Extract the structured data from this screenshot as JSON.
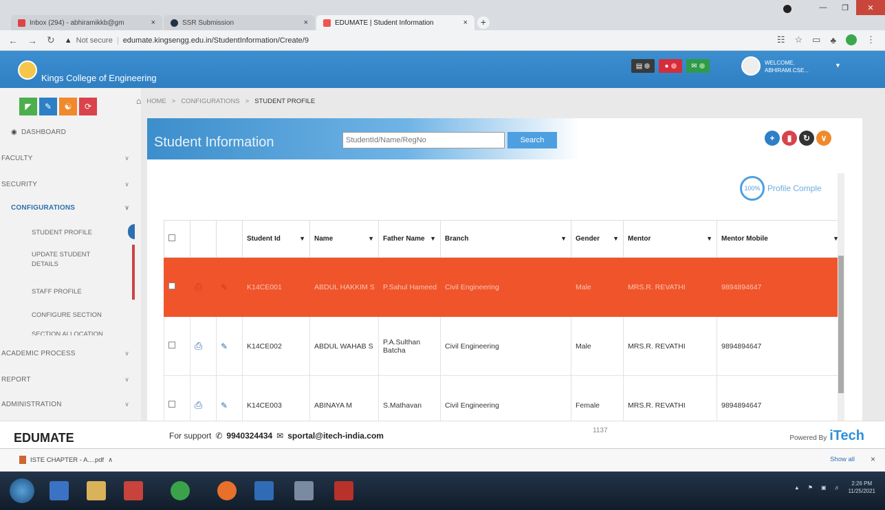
{
  "browser": {
    "tabs": [
      {
        "title": "Inbox (294) - abhiramikkb@gm",
        "close": "×"
      },
      {
        "title": "SSR Submission",
        "close": "×"
      },
      {
        "title": "EDUMATE | Student Information",
        "close": "×"
      }
    ],
    "new_tab": "+",
    "not_secure": "Not secure",
    "url": "edumate.kingsengg.edu.in/StudentInformation/Create/9"
  },
  "header": {
    "college_name": "Kings College of Engineering",
    "welcome_line1": "WELCOME,",
    "welcome_line2": "ABHIRAMI.CSE..."
  },
  "breadcrumb": [
    "HOME",
    "CONFIGURATIONS",
    "STUDENT PROFILE"
  ],
  "sidebar": {
    "menu": [
      {
        "label": "DASHBOARD"
      },
      {
        "label": "FACULTY"
      },
      {
        "label": "SECURITY"
      },
      {
        "label": "CONFIGURATIONS"
      },
      {
        "label": "ACADEMIC PROCESS"
      },
      {
        "label": "REPORT"
      },
      {
        "label": "ADMINISTRATION"
      }
    ],
    "submenu": [
      "STUDENT PROFILE",
      "UPDATE STUDENT DETAILS",
      "STAFF PROFILE",
      "CONFIGURE SECTION",
      "SECTION ALLOCATION"
    ]
  },
  "main": {
    "title": "Student Information",
    "search_placeholder": "StudentId/Name/RegNo",
    "search_label": "Search",
    "profile_percent": "100%",
    "profile_text": "Profile Comple"
  },
  "table": {
    "columns": [
      "Student Id",
      "Name",
      "Father Name",
      "Branch",
      "Gender",
      "Mentor",
      "Mentor Mobile"
    ],
    "rows": [
      {
        "id": "K14CE001",
        "name": "ABDUL HAKKIM S",
        "father": "P.Sahul Hameed",
        "branch": "Civil Engineering",
        "gender": "Male",
        "mentor": "MRS.R. REVATHI",
        "mobile": "9894894647"
      },
      {
        "id": "K14CE002",
        "name": "ABDUL WAHAB S",
        "father": "P.A.Sulthan Batcha",
        "branch": "Civil Engineering",
        "gender": "Male",
        "mentor": "MRS.R. REVATHI",
        "mobile": "9894894647"
      },
      {
        "id": "K14CE003",
        "name": "ABINAYA M",
        "father": "S.Mathavan",
        "branch": "Civil Engineering",
        "gender": "Female",
        "mentor": "MRS.R. REVATHI",
        "mobile": "9894894647"
      }
    ]
  },
  "footer": {
    "brand": "EDUMATE",
    "support_label": "For support",
    "phone": "9940324434",
    "email": "sportal@itech-india.com",
    "count": "1137",
    "powered_by": "Powered By",
    "powered_brand": "iTech"
  },
  "download": {
    "file": "ISTE CHAPTER - A....pdf",
    "show_all": "Show all",
    "close": "×"
  },
  "taskbar": {
    "time": "2:26 PM",
    "date": "11/25/2021"
  },
  "colors": {
    "header_blue": "#2f7fc2",
    "selected_row": "#f0542b",
    "accent": "#4d9fe0"
  }
}
